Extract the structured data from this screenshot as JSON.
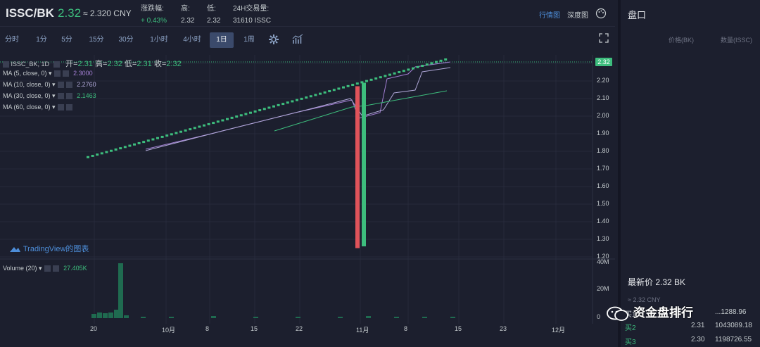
{
  "header": {
    "pair": "ISSC/BK",
    "price": "2.32",
    "cny": "≈ 2.320 CNY",
    "stats": [
      {
        "key": "涨跌幅:",
        "value": "+ 0.43%",
        "up": true
      },
      {
        "key": "高:",
        "value": "2.32",
        "up": false
      },
      {
        "key": "低:",
        "value": "2.32",
        "up": false
      },
      {
        "key": "24H交易量:",
        "value": "31610 ISSC",
        "up": false
      }
    ],
    "view_market": "行情图",
    "view_depth": "深度图"
  },
  "toolbar": {
    "intervals": [
      "分时",
      "1分",
      "5分",
      "15分",
      "30分",
      "1小时",
      "4小时",
      "1日",
      "1周"
    ],
    "selected": "1日"
  },
  "legend": {
    "symbol": "ISSC_BK, 1D",
    "open_label": "开",
    "open": "2.31",
    "high_label": "高",
    "high": "2.32",
    "low_label": "低",
    "low": "2.31",
    "close_label": "收",
    "close": "2.32",
    "mas": [
      {
        "label": "MA (5, close, 0)",
        "value": "2.3000",
        "color": "#a37fd4"
      },
      {
        "label": "MA (10, close, 0)",
        "value": "2.2760",
        "color": "#b0a8d8"
      },
      {
        "label": "MA (30, close, 0)",
        "value": "2.1463",
        "color": "#3dbd7d"
      },
      {
        "label": "MA (60, close, 0)",
        "value": "",
        "color": "#c5cbce"
      }
    ],
    "volume_label": "Volume (20)",
    "volume_value": "27.405K"
  },
  "tv_logo": "TradingView的图表",
  "current_price_tag": "2.32",
  "chart_data": {
    "type": "candlestick",
    "price_axis": [
      "2.30",
      "2.20",
      "2.10",
      "2.00",
      "1.90",
      "1.80",
      "1.70",
      "1.60",
      "1.50",
      "1.40",
      "1.30",
      "1.20"
    ],
    "volume_axis": [
      "40M",
      "20M",
      "0"
    ],
    "x_labels": [
      "20",
      "10月",
      "8",
      "15",
      "22",
      "11月",
      "8",
      "15",
      "23",
      "12月"
    ],
    "ylim": [
      1.2,
      2.32
    ],
    "candles_summary": "daily closes rising from 1.76 to 2.32 with one long red and one long green candle near 1.25 in early November",
    "volume_peak": 27405
  },
  "sidebar": {
    "title": "盘口",
    "col_price": "价格(BK)",
    "col_qty": "数量(ISSC)",
    "last_price": "最新价 2.32 BK",
    "last_cny": "≈ 2.32 CNY",
    "book": [
      {
        "side": "买1",
        "price": "",
        "qty": "...1288.96"
      },
      {
        "side": "买2",
        "price": "2.31",
        "qty": "1043089.18"
      },
      {
        "side": "买3",
        "price": "2.30",
        "qty": "1198726.55"
      }
    ]
  },
  "watermark": "资金盘排行"
}
